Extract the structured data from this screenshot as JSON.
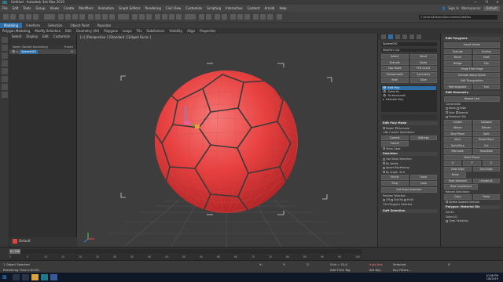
{
  "title_bar": {
    "title": "Untitled - Autodesk 3ds Max 2019",
    "controls": [
      "—",
      "❐",
      "✕"
    ]
  },
  "menu": {
    "items": [
      "File",
      "Edit",
      "Tools",
      "Group",
      "Views",
      "Create",
      "Modifiers",
      "Animation",
      "Graph Editors",
      "Rendering",
      "Civil View",
      "Customize",
      "Scripting",
      "Interactive",
      "Content",
      "Arnold",
      "Help"
    ],
    "user": "Sign In",
    "workspace_label": "Workspaces:",
    "workspace_value": "Default"
  },
  "toolbar": {
    "path": "C:\\Users\\Elwane\\Documents\\3dsMax"
  },
  "ribbon": {
    "tabs": [
      "Modeling",
      "Freeform",
      "Selection",
      "Object Paint",
      "Populate"
    ],
    "active_tab": "Modeling",
    "items": [
      "Polygon Modeling",
      "Modify Selection",
      "Edit",
      "Geometry (All)",
      "Polygons",
      "Loops",
      "Tris",
      "Subdivision",
      "Visibility",
      "Align",
      "Properties"
    ]
  },
  "explorer": {
    "tabs": [
      "Select",
      "Display",
      "Edit",
      "Customize"
    ],
    "header_name": "Name (Sorted Ascending)",
    "header_frozen": "Frozen",
    "rows": [
      {
        "name": "Sphere001",
        "frozen": ""
      }
    ],
    "footer": "Default"
  },
  "viewport": {
    "label": "[+] [Perspective ] [Standard ] [Edged Faces ]",
    "sphere_color": "#e8403f"
  },
  "modify_panel": {
    "object_name": "Sphere001",
    "modifier_list": "Modifier List",
    "buttons": [
      "Select",
      "Bend",
      "Extrude",
      "Noise",
      "Cap Holes",
      "FFD 2x2x2",
      "Turbosmooth",
      "Symmetry",
      "Shell",
      "Slice"
    ],
    "stack": [
      {
        "label": "Edit Poly",
        "selected": true
      },
      {
        "label": "Spherify",
        "selected": false
      },
      {
        "label": "Turbosmooth",
        "selected": false
      },
      {
        "label": "Editable Poly",
        "selected": false
      }
    ],
    "rollouts": {
      "edit_poly_mode": "Edit Poly Mode",
      "mode_model": "Model",
      "mode_animate": "Animate",
      "no_current_op": "<No Current Operation>",
      "commit": "Commit",
      "settings": "Settings",
      "cancel": "Cancel",
      "show_cage": "Show Cage",
      "selection": "Selection",
      "use_stack_selection": "Use Stack Selection",
      "by_vertex": "By Vertex",
      "ignore_backfacing": "Ignore Backfacing",
      "by_angle": "By Angle:",
      "angle_value": "45.0",
      "shrink": "Shrink",
      "grow": "Grow",
      "ring": "Ring",
      "loop": "Loop",
      "get_stack_selection": "Get Stack Selection",
      "preview_selection": "Preview Selection",
      "off": "Off",
      "subobj": "SubObj",
      "multi": "Multi",
      "selected_count": "720 Polygons Selected",
      "soft_selection": "Soft Selection"
    }
  },
  "edit_polygons": {
    "title": "Edit Polygons",
    "buttons": [
      "Insert Vertex",
      "Extrude",
      "Outline",
      "Bevel",
      "Inset",
      "Bridge",
      "Flip",
      "Hinge From Edge",
      "Extrude Along Spline",
      "Edit Triangulation",
      "Retriangulate",
      "Turn"
    ],
    "edit_geometry": "Edit Geometry",
    "repeat_last": "Repeat Last",
    "constraints": "Constraints",
    "none": "None",
    "edge": "Edge",
    "face": "Face",
    "normal": "Normal",
    "preserve_uvs": "Preserve UVs",
    "geo_buttons": [
      "Create",
      "Collapse",
      "Attach",
      "Detach",
      "Slice Plane",
      "Split",
      "Slice",
      "Reset Plane",
      "QuickSlice",
      "Cut",
      "MSmooth",
      "Tessellate",
      "Make Planar",
      "X",
      "Y",
      "Z",
      "View Align",
      "Grid Align",
      "Relax",
      "Hide Selected",
      "Unhide All",
      "Hide Unselected"
    ],
    "named_selections": "Named Selections:",
    "copy": "Copy",
    "paste": "Paste",
    "delete_isolated": "Delete Isolated Vertices",
    "material_ids": "Polygon: Material IDs",
    "set_id": "Set ID:",
    "select_id": "Select ID",
    "clear_selection": "Clear Selection"
  },
  "timeline": {
    "frame_label": "0 / 100",
    "ticks": [
      "0",
      "5",
      "10",
      "15",
      "20",
      "25",
      "30",
      "35",
      "40",
      "45",
      "50",
      "55",
      "60",
      "65",
      "70",
      "75",
      "80",
      "85",
      "90",
      "95",
      "100"
    ]
  },
  "status": {
    "objects_selected": "1 Object Selected",
    "rendering_time": "Rendering Time  0:00:00",
    "x_label": "X:",
    "y_label": "Y:",
    "z_label": "Z:",
    "grid": "Grid = 10,0",
    "add_time_tag": "Add Time Tag",
    "auto_key": "Auto Key",
    "selected": "Selected",
    "set_key": "Set Key",
    "key_filters": "Key Filters...",
    "frame": "0"
  },
  "taskbar": {
    "time": "10:06 PM",
    "date": "1/8/2019"
  }
}
